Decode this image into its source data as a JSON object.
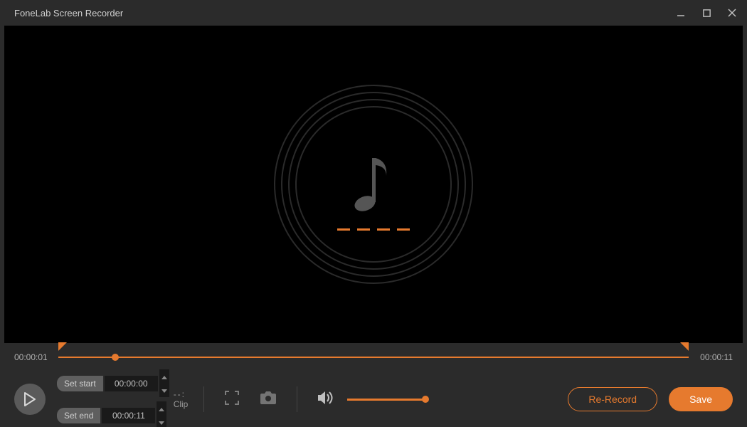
{
  "window": {
    "title": "FoneLab Screen Recorder"
  },
  "timeline": {
    "current_time": "00:00:01",
    "total_time": "00:00:11"
  },
  "clip": {
    "set_start_label": "Set start",
    "set_end_label": "Set end",
    "start_value": "00:00:00",
    "end_value": "00:00:11",
    "clip_label": "Clip",
    "dashes": "--:"
  },
  "actions": {
    "re_record_label": "Re-Record",
    "save_label": "Save"
  },
  "colors": {
    "accent": "#e67a2e"
  }
}
